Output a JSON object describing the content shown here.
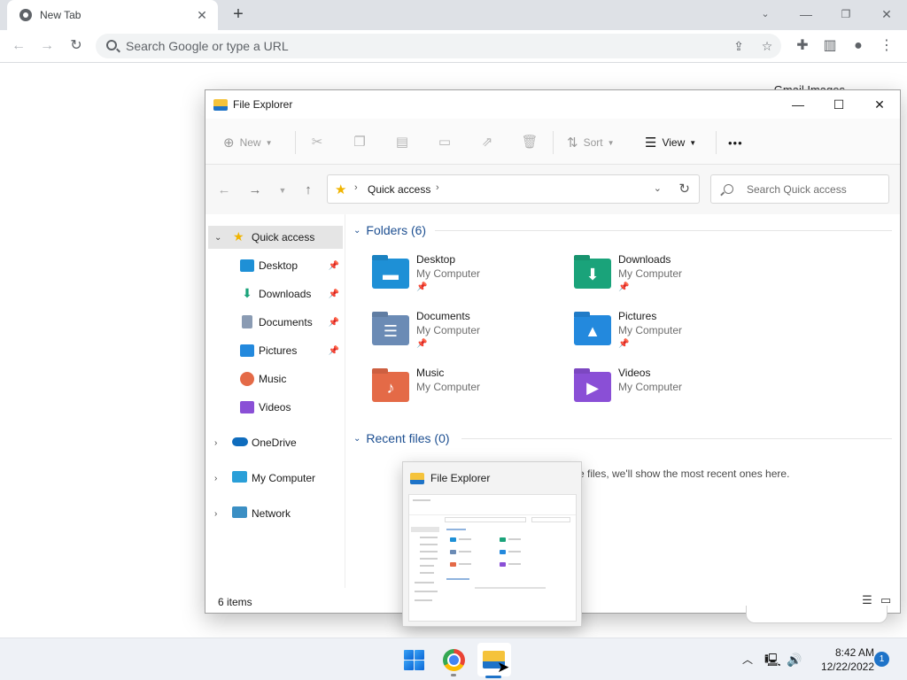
{
  "browser": {
    "tab_title": "New Tab",
    "tab_close": "✕",
    "new_tab": "+",
    "omnibox_placeholder": "Search Google or type a URL",
    "top_links": "Gmail   Images"
  },
  "explorer": {
    "title": "File Explorer",
    "toolbar": {
      "new_label": "New",
      "sort_label": "Sort",
      "view_label": "View",
      "more": "•••"
    },
    "address": {
      "location": "Quick access",
      "search_placeholder": "Search Quick access"
    },
    "sidebar": {
      "quick_access": "Quick access",
      "pinned": [
        {
          "label": "Desktop"
        },
        {
          "label": "Downloads"
        },
        {
          "label": "Documents"
        },
        {
          "label": "Pictures"
        }
      ],
      "music": "Music",
      "videos": "Videos",
      "onedrive": "OneDrive",
      "my_computer": "My Computer",
      "network": "Network"
    },
    "folders_header": "Folders (6)",
    "folders": [
      {
        "name": "Desktop",
        "location": "My Computer",
        "pinned": true,
        "color": "#1e90d6",
        "glyph": "▬"
      },
      {
        "name": "Downloads",
        "location": "My Computer",
        "pinned": true,
        "color": "#1aa37a",
        "glyph": "⬇"
      },
      {
        "name": "Documents",
        "location": "My Computer",
        "pinned": true,
        "color": "#6b8bb5",
        "glyph": "☰"
      },
      {
        "name": "Pictures",
        "location": "My Computer",
        "pinned": true,
        "color": "#2389dd",
        "glyph": "▲"
      },
      {
        "name": "Music",
        "location": "My Computer",
        "pinned": false,
        "color": "#e46a47",
        "glyph": "♪"
      },
      {
        "name": "Videos",
        "location": "My Computer",
        "pinned": false,
        "color": "#8a4fd6",
        "glyph": "▶"
      }
    ],
    "recent_header": "Recent files (0)",
    "recent_message": "e files, we'll show the most recent ones here.",
    "status_count": "6 items"
  },
  "thumbnail": {
    "title": "File Explorer"
  },
  "taskbar": {
    "time": "8:42 AM",
    "date": "12/22/2022",
    "notification_count": "1"
  },
  "colors": {
    "accent": "#1e73c8",
    "folder_yellow": "#f5c33b",
    "star": "#f0b400"
  }
}
